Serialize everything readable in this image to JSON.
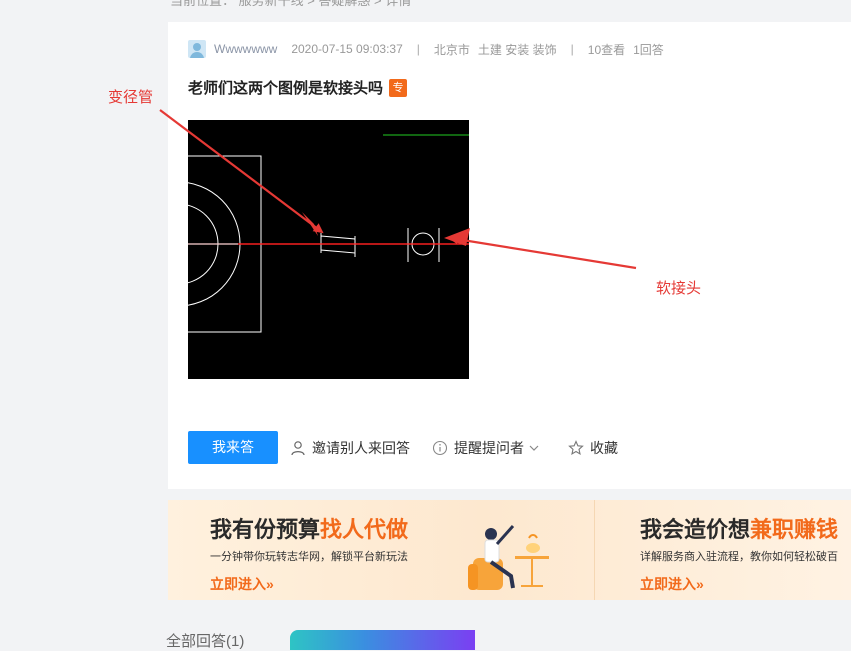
{
  "breadcrumb": "当前位置： 服务新干线 > 答疑解惑 > 详情",
  "post": {
    "username": "Wwwwwww",
    "datetime": "2020-07-15 09:03:37",
    "location": "北京市",
    "tags": [
      "土建",
      "安装",
      "装饰"
    ],
    "views": "10查看",
    "answers": "1回答",
    "title": "老师们这两个图例是软接头吗",
    "badge": "专"
  },
  "annotations": {
    "left_label": "变径管",
    "right_label": "软接头"
  },
  "actions": {
    "answer_button": "我来答",
    "invite": "邀请别人来回答",
    "remind": "提醒提问者",
    "favorite": "收藏"
  },
  "banner": {
    "left": {
      "title_plain": "我有份预算",
      "title_highlight": "找人代做",
      "subtitle": "一分钟带你玩转志华网，解锁平台新玩法",
      "link": "立即进入»"
    },
    "right": {
      "title_plain": "我会造价想",
      "title_highlight": "兼职赚钱",
      "subtitle": "详解服务商入驻流程，教你如何轻松破百",
      "link": "立即进入»"
    }
  },
  "bottom": {
    "all_answers": "全部回答(1)"
  },
  "colors": {
    "primary": "#1890ff",
    "accent": "#f26a1b",
    "annotation": "#e53935"
  }
}
